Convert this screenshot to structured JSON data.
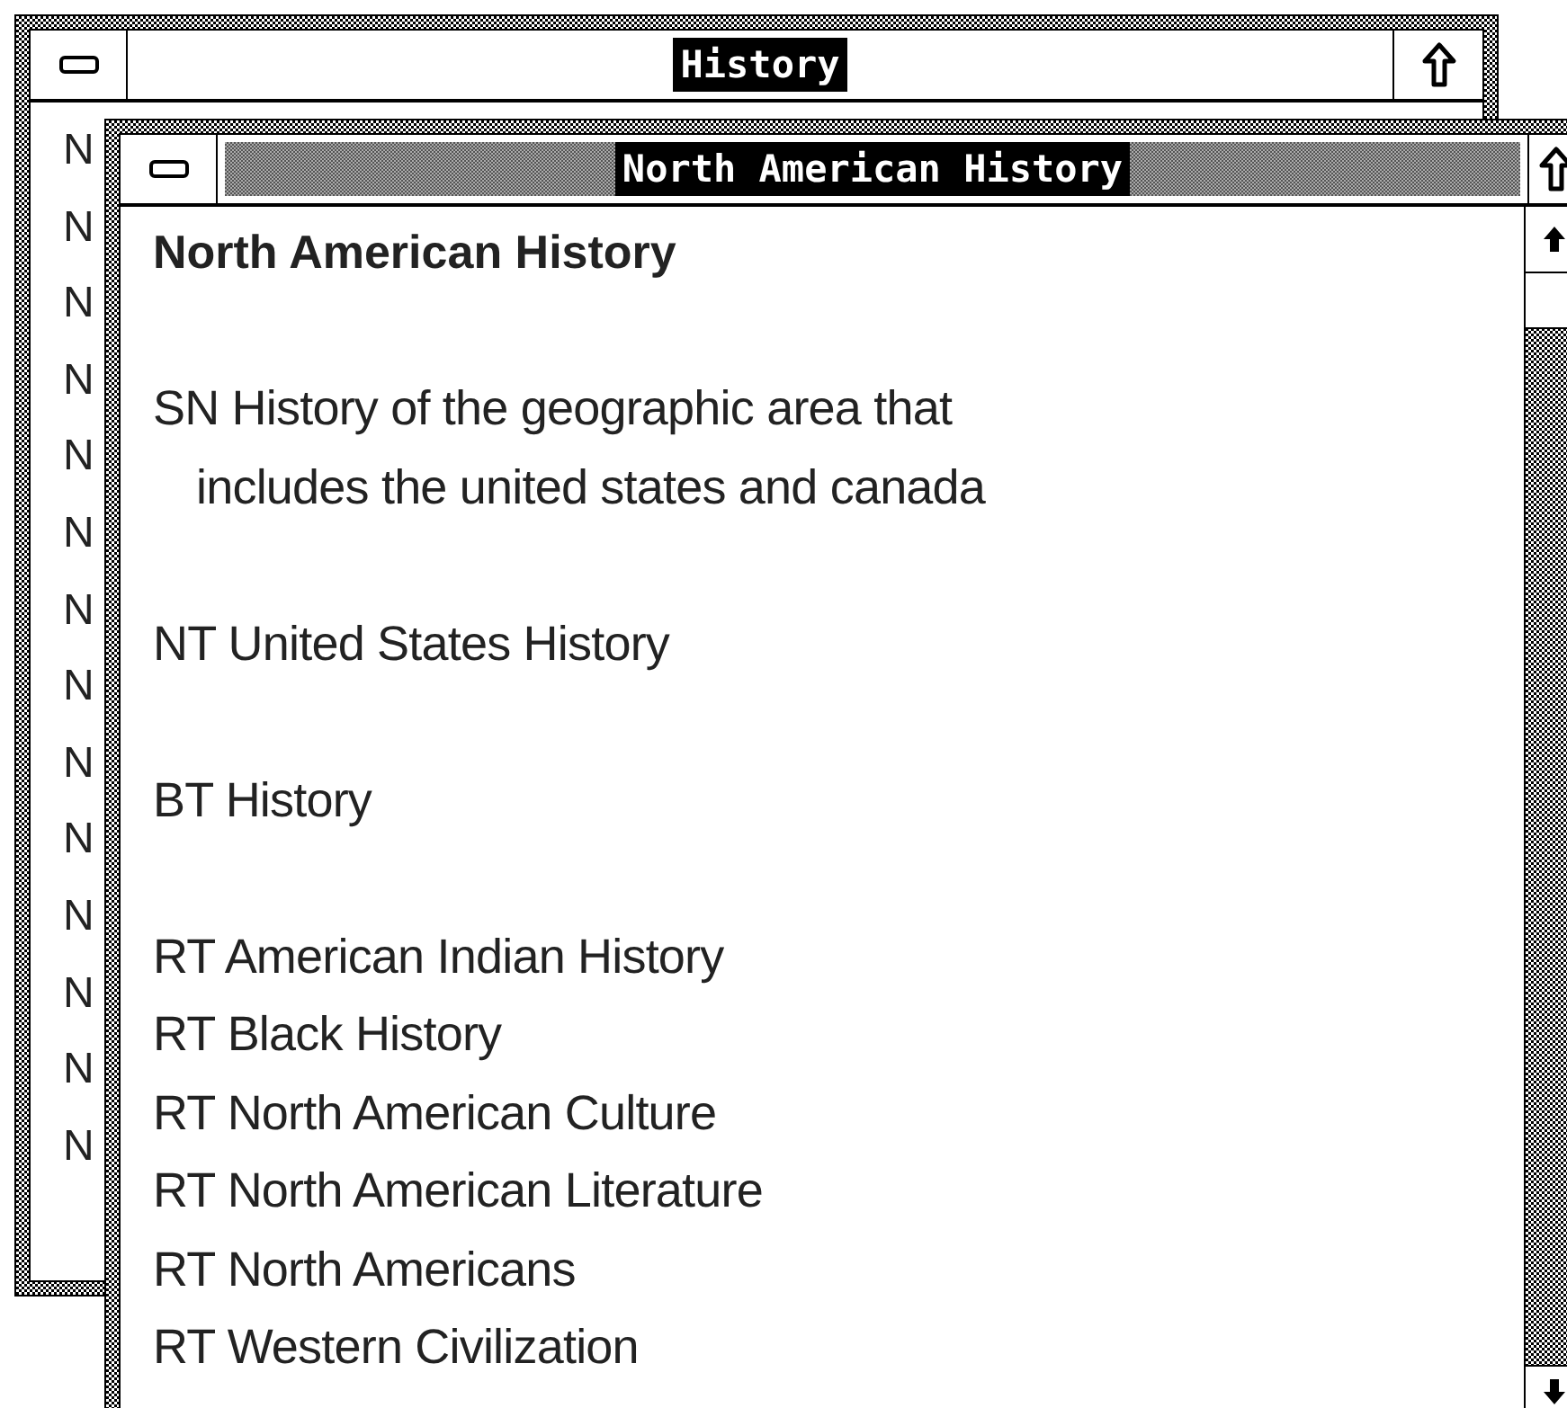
{
  "windows": [
    {
      "title": "History",
      "active": false,
      "items": [
        "N",
        "N",
        "N",
        "N",
        "N",
        "N",
        "N",
        "N",
        "N",
        "N",
        "N",
        "N",
        "N",
        "N"
      ]
    },
    {
      "title": "North American History",
      "active": true,
      "entries": [
        {
          "kind": "heading",
          "lines": [
            "North American History"
          ]
        },
        {
          "kind": "blank"
        },
        {
          "kind": "note",
          "lines": [
            "SN History of the geographic area that",
            "includes the united states and canada"
          ]
        },
        {
          "kind": "blank"
        },
        {
          "kind": "term",
          "lines": [
            "NT United States History"
          ]
        },
        {
          "kind": "blank"
        },
        {
          "kind": "term",
          "lines": [
            "BT History"
          ]
        },
        {
          "kind": "blank"
        },
        {
          "kind": "term",
          "lines": [
            "RT American Indian History"
          ]
        },
        {
          "kind": "term",
          "lines": [
            "RT Black History"
          ]
        },
        {
          "kind": "term",
          "lines": [
            "RT North American Culture"
          ]
        },
        {
          "kind": "term",
          "lines": [
            "RT North American Literature"
          ]
        },
        {
          "kind": "term",
          "lines": [
            "RT North Americans"
          ]
        },
        {
          "kind": "term",
          "lines": [
            "RT Western Civilization"
          ]
        }
      ]
    }
  ]
}
